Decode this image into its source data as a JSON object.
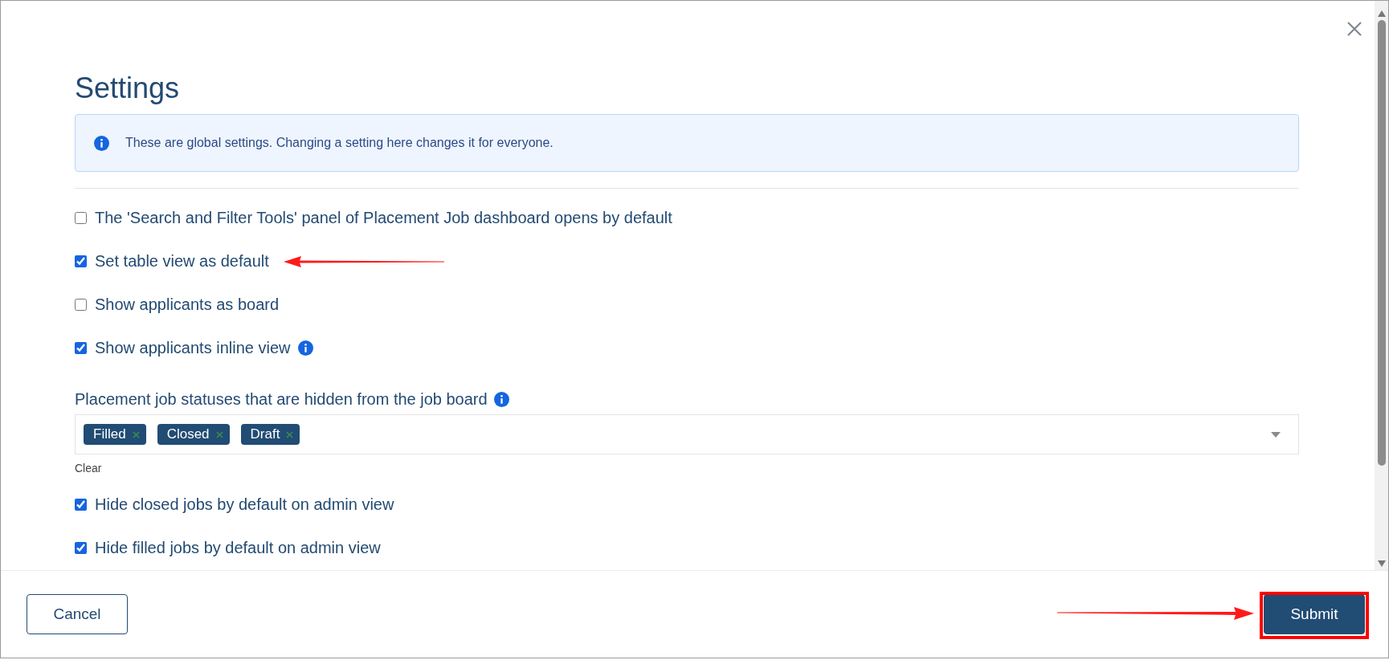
{
  "title": "Settings",
  "notice": "These are global settings. Changing a setting here changes it for everyone.",
  "options": [
    {
      "label": "The 'Search and Filter Tools' panel of Placement Job dashboard opens by default",
      "checked": false,
      "info": false
    },
    {
      "label": "Set table view as default",
      "checked": true,
      "info": false
    },
    {
      "label": "Show applicants as board",
      "checked": false,
      "info": false
    },
    {
      "label": "Show applicants inline view",
      "checked": true,
      "info": true
    }
  ],
  "statuses": {
    "label": "Placement job statuses that are hidden from the job board",
    "tags": [
      "Filled",
      "Closed",
      "Draft"
    ],
    "clear": "Clear"
  },
  "more_options": [
    {
      "label": "Hide closed jobs by default on admin view",
      "checked": true,
      "info": false
    },
    {
      "label": "Hide filled jobs by default on admin view",
      "checked": true,
      "info": false
    }
  ],
  "buttons": [
    {
      "label": "Cancel",
      "kind": "secondary"
    },
    {
      "label": "Submit",
      "kind": "primary"
    }
  ]
}
